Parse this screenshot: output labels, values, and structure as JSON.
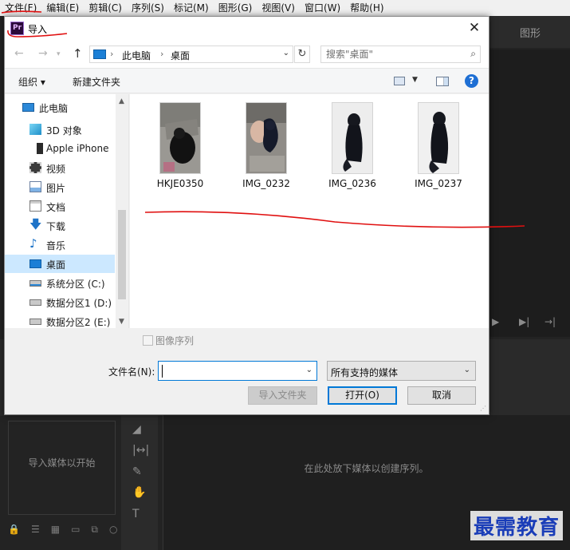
{
  "menubar": {
    "items": [
      "文件(F)",
      "编辑(E)",
      "剪辑(C)",
      "序列(S)",
      "标记(M)",
      "图形(G)",
      "视图(V)",
      "窗口(W)",
      "帮助(H)"
    ]
  },
  "premiere": {
    "graphics_tab": "图形",
    "import_hint": "导入媒体以开始",
    "drop_hint": "在此处放下媒体以创建序列。",
    "watermark": "最需教育"
  },
  "dialog": {
    "app_icon_text": "Pr",
    "title": "导入",
    "close_glyph": "✕",
    "nav": {
      "back_glyph": "←",
      "forward_glyph": "→",
      "up_glyph": "↑",
      "address_crumbs": [
        "此电脑",
        "桌面"
      ],
      "address_sep": "›",
      "refresh_glyph": "↻",
      "search_placeholder": "搜索\"桌面\"",
      "search_icon": "search-icon"
    },
    "toolbar": {
      "organize_label": "组织 ▾",
      "new_folder_label": "新建文件夹",
      "help_glyph": "?"
    },
    "sidebar": {
      "items": [
        {
          "label": "此电脑",
          "icon": "computer-icon",
          "selected": false
        },
        {
          "label": "3D 对象",
          "icon": "3d-objects-icon",
          "selected": false
        },
        {
          "label": "Apple iPhone",
          "icon": "phone-icon",
          "selected": false
        },
        {
          "label": "视频",
          "icon": "video-icon",
          "selected": false
        },
        {
          "label": "图片",
          "icon": "pictures-icon",
          "selected": false
        },
        {
          "label": "文档",
          "icon": "documents-icon",
          "selected": false
        },
        {
          "label": "下载",
          "icon": "download-icon",
          "selected": false
        },
        {
          "label": "音乐",
          "icon": "music-icon",
          "selected": false
        },
        {
          "label": "桌面",
          "icon": "desktop-icon",
          "selected": true
        },
        {
          "label": "系统分区 (C:)",
          "icon": "drive-c-icon",
          "selected": false
        },
        {
          "label": "数据分区1 (D:)",
          "icon": "drive-d-icon",
          "selected": false
        },
        {
          "label": "数据分区2 (E:)",
          "icon": "drive-e-icon",
          "selected": false
        }
      ]
    },
    "files": [
      {
        "name": "HKJE0350",
        "thumb": "dog-on-pavement-thumbnail"
      },
      {
        "name": "IMG_0232",
        "thumb": "hand-holding-puppy-thumbnail"
      },
      {
        "name": "IMG_0236",
        "thumb": "black-dog-sitting-thumbnail"
      },
      {
        "name": "IMG_0237",
        "thumb": "black-dog-sitting-thumbnail"
      }
    ],
    "image_sequence_label": "图像序列",
    "filename_label": "文件名(N):",
    "filename_value": "",
    "filetype_value": "所有支持的媒体",
    "buttons": {
      "import_folder": "导入文件夹",
      "open": "打开(O)",
      "cancel": "取消"
    }
  },
  "colors": {
    "annotation_red": "#e01010",
    "selection_blue": "#cce8ff",
    "accent_blue": "#0078d7"
  }
}
